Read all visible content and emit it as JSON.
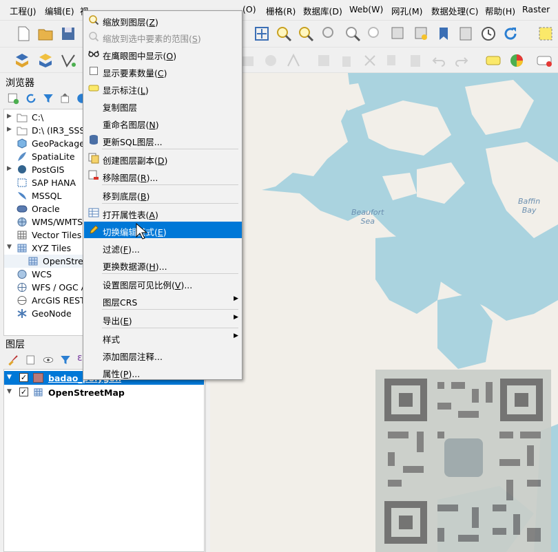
{
  "menubar": {
    "items": [
      "工程(J)",
      "编辑(E)",
      "视",
      "(O)",
      "栅格(R)",
      "数据库(D)",
      "Web(W)",
      "网孔(M)",
      "数据处理(C)",
      "帮助(H)",
      "Raster"
    ]
  },
  "browser": {
    "title": "浏览器",
    "items": [
      {
        "label": "C:\\",
        "icon": "folder-icon",
        "arrow": "▶"
      },
      {
        "label": "D:\\ (IR3_SSS_",
        "icon": "folder-icon",
        "arrow": "▶"
      },
      {
        "label": "GeoPackage",
        "icon": "geopackage-icon",
        "arrow": ""
      },
      {
        "label": "SpatiaLite",
        "icon": "spatialite-icon",
        "arrow": ""
      },
      {
        "label": "PostGIS",
        "icon": "postgis-icon",
        "arrow": "▶"
      },
      {
        "label": "SAP HANA",
        "icon": "saphana-icon",
        "arrow": ""
      },
      {
        "label": "MSSQL",
        "icon": "mssql-icon",
        "arrow": ""
      },
      {
        "label": "Oracle",
        "icon": "oracle-icon",
        "arrow": ""
      },
      {
        "label": "WMS/WMTS",
        "icon": "wms-icon",
        "arrow": ""
      },
      {
        "label": "Vector Tiles",
        "icon": "vector-tiles-icon",
        "arrow": ""
      },
      {
        "label": "XYZ Tiles",
        "icon": "xyz-tiles-icon",
        "arrow": "▼"
      },
      {
        "label": "OpenStree",
        "icon": "xyz-layer-icon",
        "arrow": ""
      },
      {
        "label": "WCS",
        "icon": "wcs-icon",
        "arrow": ""
      },
      {
        "label": "WFS / OGC A",
        "icon": "wfs-icon",
        "arrow": ""
      },
      {
        "label": "ArcGIS REST",
        "icon": "arcgis-icon",
        "arrow": ""
      },
      {
        "label": "GeoNode",
        "icon": "geonode-icon",
        "arrow": ""
      }
    ]
  },
  "layers": {
    "title": "图层",
    "items": [
      {
        "label": "badao_polygon",
        "checked": true,
        "selected": true
      },
      {
        "label": "OpenStreetMap",
        "checked": true,
        "selected": false
      }
    ]
  },
  "map": {
    "labels": {
      "beaufort": "Beaufort\nSea",
      "baffin": "Baffin\nBay"
    },
    "colors": {
      "water": "#aad3df",
      "land": "#f2efe9"
    }
  },
  "context_menu": {
    "items": [
      {
        "label": "缩放到图层(",
        "key": "Z",
        "tail": ")",
        "icon": "zoom-layer-icon",
        "disabled": false
      },
      {
        "label": "缩放到选中要素的范围(",
        "key": "S",
        "tail": ")",
        "icon": "zoom-selection-icon",
        "disabled": true
      },
      {
        "label": "在鹰眼图中显示(",
        "key": "O",
        "tail": ")",
        "icon": "overview-glasses-icon",
        "disabled": false
      },
      {
        "label": "显示要素数量(",
        "key": "C",
        "tail": ")",
        "icon": "checkbox-icon",
        "disabled": false
      },
      {
        "label": "显示标注(",
        "key": "L",
        "tail": ")",
        "icon": "label-abc-icon",
        "disabled": false
      },
      {
        "label": "复制图层",
        "key": "",
        "tail": "",
        "icon": "",
        "disabled": false
      },
      {
        "label": "重命名图层(",
        "key": "N",
        "tail": ")",
        "icon": "",
        "disabled": false
      },
      {
        "label": "更新SQL图层...",
        "key": "",
        "tail": "",
        "icon": "database-icon",
        "disabled": false
      },
      {
        "label": "创建图层副本(",
        "key": "D",
        "tail": ")",
        "icon": "duplicate-layer-icon",
        "disabled": false
      },
      {
        "label": "移除图层(",
        "key": "R",
        "tail": ")...",
        "icon": "remove-layer-icon",
        "disabled": false
      },
      {
        "label": "移到底层(",
        "key": "B",
        "tail": ")",
        "icon": "",
        "disabled": false
      },
      {
        "label": "打开属性表(",
        "key": "A",
        "tail": ")",
        "icon": "attribute-table-icon",
        "disabled": false
      },
      {
        "label": "切换编辑模式(",
        "key": "E",
        "tail": ")",
        "icon": "pencil-icon",
        "disabled": false
      },
      {
        "label": "过滤(",
        "key": "F",
        "tail": ")...",
        "icon": "",
        "disabled": false
      },
      {
        "label": "更换数据源(",
        "key": "H",
        "tail": ")...",
        "icon": "",
        "disabled": false
      },
      {
        "label": "设置图层可见比例(",
        "key": "V",
        "tail": ")...",
        "icon": "",
        "disabled": false
      },
      {
        "label": "图层CRS",
        "key": "",
        "tail": "",
        "icon": "",
        "disabled": false
      },
      {
        "label": "导出(",
        "key": "E",
        "tail": ")",
        "icon": "",
        "disabled": false
      },
      {
        "label": "样式",
        "key": "",
        "tail": "",
        "icon": "",
        "disabled": false
      },
      {
        "label": "添加图层注释...",
        "key": "",
        "tail": "",
        "icon": "",
        "disabled": false
      },
      {
        "label": "属性(",
        "key": "P",
        "tail": ")...",
        "icon": "",
        "disabled": false
      }
    ],
    "highlighted_index": 12,
    "submenu_arrow": "▶"
  }
}
